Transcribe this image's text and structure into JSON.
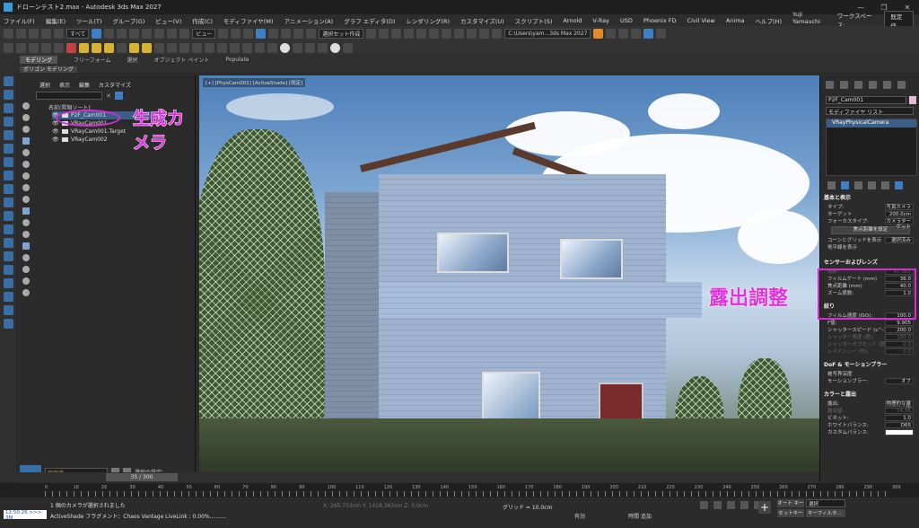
{
  "window": {
    "title": "ドローンテスト2.max - Autodesk 3ds Max 2027",
    "buttons": [
      "—",
      "❐",
      "✕"
    ]
  },
  "menu": {
    "items": [
      "ファイル(F)",
      "編集(E)",
      "ツール(T)",
      "グループ(G)",
      "ビュー(V)",
      "作成(C)",
      "モディファイヤ(M)",
      "アニメーション(A)",
      "グラフ エディタ(D)",
      "レンダリング(R)",
      "カスタマイズ(U)",
      "スクリプト(S)",
      "Arnold",
      "V-Ray",
      "USD",
      "Phoenix FD",
      "Civil View",
      "Anima",
      "ヘルプ(H)"
    ],
    "user": "Yuji Yamauchi",
    "workspace_label": "ワークスペース:",
    "workspace_value": "既定値"
  },
  "toolbar": {
    "filter_dropdown": "すべて",
    "view_dropdown": "ビュー",
    "selection_set": "選択セット作成",
    "path": "C:\\Users\\yam...3ds Max 2027"
  },
  "ribbon": {
    "tabs": [
      "モデリング",
      "フリーフォーム",
      "選択",
      "オブジェクト ペイント",
      "Populate"
    ],
    "sub": "ポリゴン モデリング"
  },
  "scene_explorer": {
    "tabs": [
      "選択",
      "表示",
      "編集",
      "カスタマイズ"
    ],
    "header": "名前(昇順ソート)",
    "rows": [
      {
        "label": "P2F_Cam001",
        "selected": true
      },
      {
        "label": "VRayCam001",
        "selected": false
      },
      {
        "label": "VRayCam001.Target",
        "selected": false
      },
      {
        "label": "VRayCam002",
        "selected": false
      }
    ],
    "layer_dropdown": "既定値",
    "selection_set_label": "選択の設定:"
  },
  "viewport": {
    "label": "[+] [PhysCam001] [ActiveShade] [既定]"
  },
  "annotations": {
    "camera_create": "生成カメラ",
    "exposure_adjust": "露出調整",
    "color": "#e030e0"
  },
  "command_panel": {
    "name": "P2F_Cam001",
    "modifier_list": "モディファイヤ リスト",
    "stack_item": "VRayPhysicalCamera",
    "basic": {
      "title": "基本と表示",
      "type_label": "タイプ:",
      "type_value": "写真カメラ",
      "target_label": "ターゲット",
      "target_value": "200.0cm",
      "focus_label": "フォーカスタイプ:",
      "focus_value": "カメラターゲット",
      "focus_btn": "焦点距離を設定",
      "guide_label": "コーンとグリッドを表示",
      "guide_value": "選択済み",
      "horizon": "地平線を表示"
    },
    "sensor": {
      "title": "センサーおよびレンズ",
      "rows": [
        {
          "label": "視野:",
          "value": "47.565",
          "dim": true
        },
        {
          "label": "フィルムゲート (mm)",
          "value": "36.0",
          "dim": false
        },
        {
          "label": "焦点距離 (mm)",
          "value": "40.0",
          "dim": false
        },
        {
          "label": "ズーム係数:",
          "value": "1.0",
          "dim": false
        }
      ]
    },
    "aperture": {
      "title": "絞り",
      "rows": [
        {
          "label": "フィルム速度 (ISO):",
          "value": "100.0",
          "dim": false
        },
        {
          "label": "F値:",
          "value": "9.905",
          "dim": false
        },
        {
          "label": "シャッタースピード (s^-1):",
          "value": "200.0",
          "dim": false
        },
        {
          "label": "シャッター角度 (度):",
          "value": "180.0",
          "dim": true
        },
        {
          "label": "シャッターオフセット (度):",
          "value": "0.0",
          "dim": true
        },
        {
          "label": "レイテンシー (秒):",
          "value": "0.0",
          "dim": true
        }
      ]
    },
    "dof": {
      "title": "DoF & モーションブラー",
      "dof_label": "被写界深度",
      "mb_label": "モーションブラー:",
      "mb_value": "オフ"
    },
    "color": {
      "title": "カラーと露出",
      "exposure_label": "露出:",
      "exposure_value": "物理的な露出",
      "ev_label": "露出値:",
      "ev_value": "14.56",
      "vignette_label": "ビネット:",
      "vignette_value": "1.0",
      "wb_label": "ホワイトバランス:",
      "wb_value": "D65",
      "custom_wb": "カスタムバランス:"
    }
  },
  "timeline": {
    "slider": "35 / 300",
    "ticks": [
      "0",
      "10",
      "20",
      "30",
      "40",
      "50",
      "60",
      "70",
      "80",
      "90",
      "100",
      "110",
      "120",
      "130",
      "140",
      "150",
      "160",
      "170",
      "180",
      "190",
      "200",
      "210",
      "220",
      "230",
      "240",
      "250",
      "260",
      "270",
      "280",
      "290",
      "300"
    ]
  },
  "status": {
    "line1": "1 個のカメラが選択されました",
    "line2": "ActiveShade フラグメント：Chaos Vantage LiveLink : 0.00%..........",
    "script": "12:50:26 >>> 3M",
    "grid": "グリッド = 10.0cm",
    "coords": "X: 265.753cm  Y: 1428.363cm  Z: 0.0cm",
    "active": "有効",
    "time": "時間 追加",
    "autokey": "オート キー",
    "setkey": "セットキー",
    "sel_dropdown": "選択",
    "key_filter": "キーフィルタ..."
  }
}
